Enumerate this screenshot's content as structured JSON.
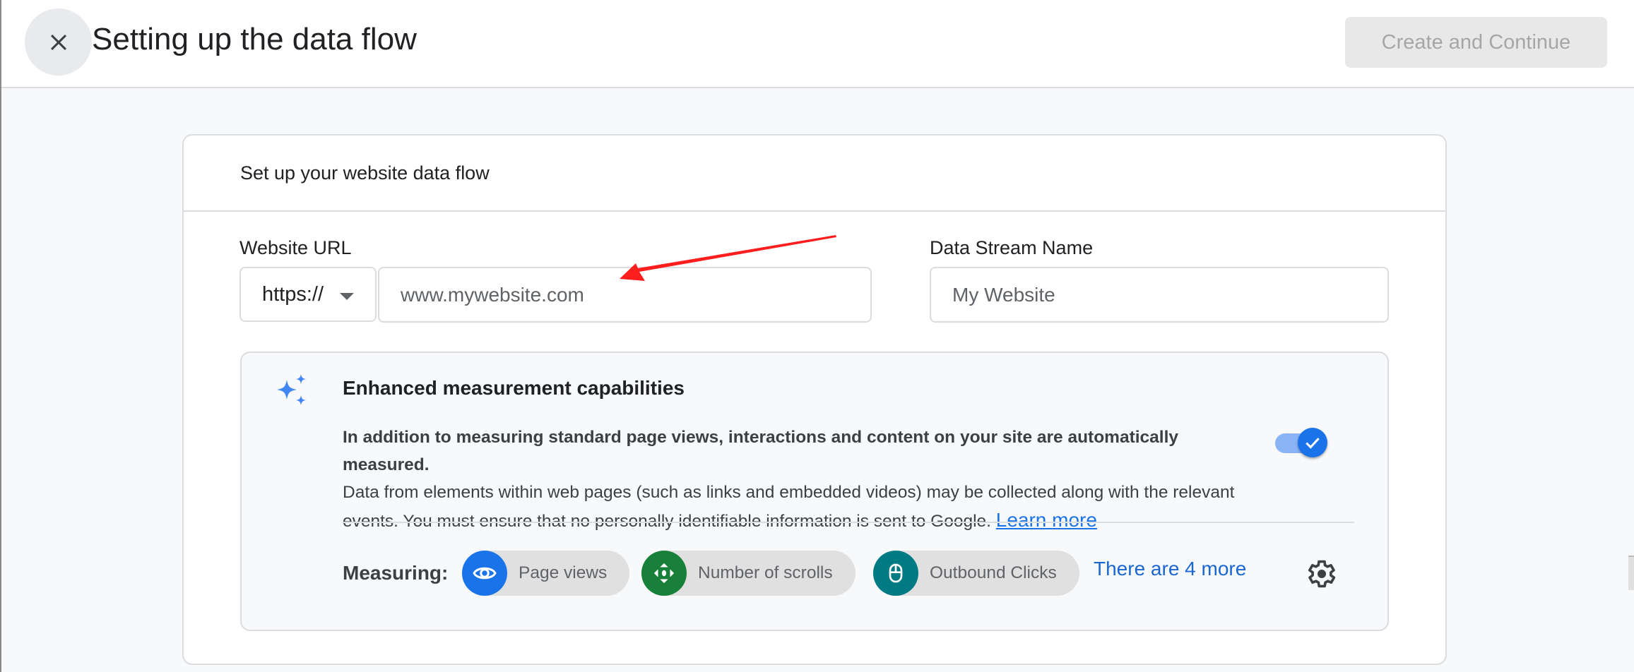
{
  "header": {
    "title": "Setting up the data flow",
    "close_icon": "close-icon",
    "primary_button": "Create and Continue"
  },
  "card": {
    "title": "Set up your website data flow",
    "website_url": {
      "label": "Website URL",
      "protocol_selected": "https://",
      "placeholder": "www.mywebsite.com",
      "value": ""
    },
    "stream_name": {
      "label": "Data Stream Name",
      "placeholder": "My Website",
      "value": ""
    }
  },
  "enhanced": {
    "icon": "sparkle-icon",
    "title": "Enhanced measurement capabilities",
    "desc_bold": "In addition to measuring standard page views, interactions and content on your site are automatically measured.",
    "desc_text": "Data from elements within web pages (such as links and embedded videos) may be collected along with the relevant events. You must ensure that no personally identifiable information is sent to Google.",
    "learn_more": "Learn more",
    "toggle_on": true,
    "measuring_label": "Measuring:",
    "chips": [
      {
        "label": "Page views",
        "icon": "eye-icon",
        "color": "#1a73e8"
      },
      {
        "label": "Number of scrolls",
        "icon": "scroll-arrows-icon",
        "color": "#188038"
      },
      {
        "label": "Outbound Clicks",
        "icon": "mouse-icon",
        "color": "#007b83"
      }
    ],
    "more_link": "There are 4 more",
    "settings_icon": "gear-icon"
  },
  "annotation": {
    "arrow_color": "#ff1e1e"
  }
}
